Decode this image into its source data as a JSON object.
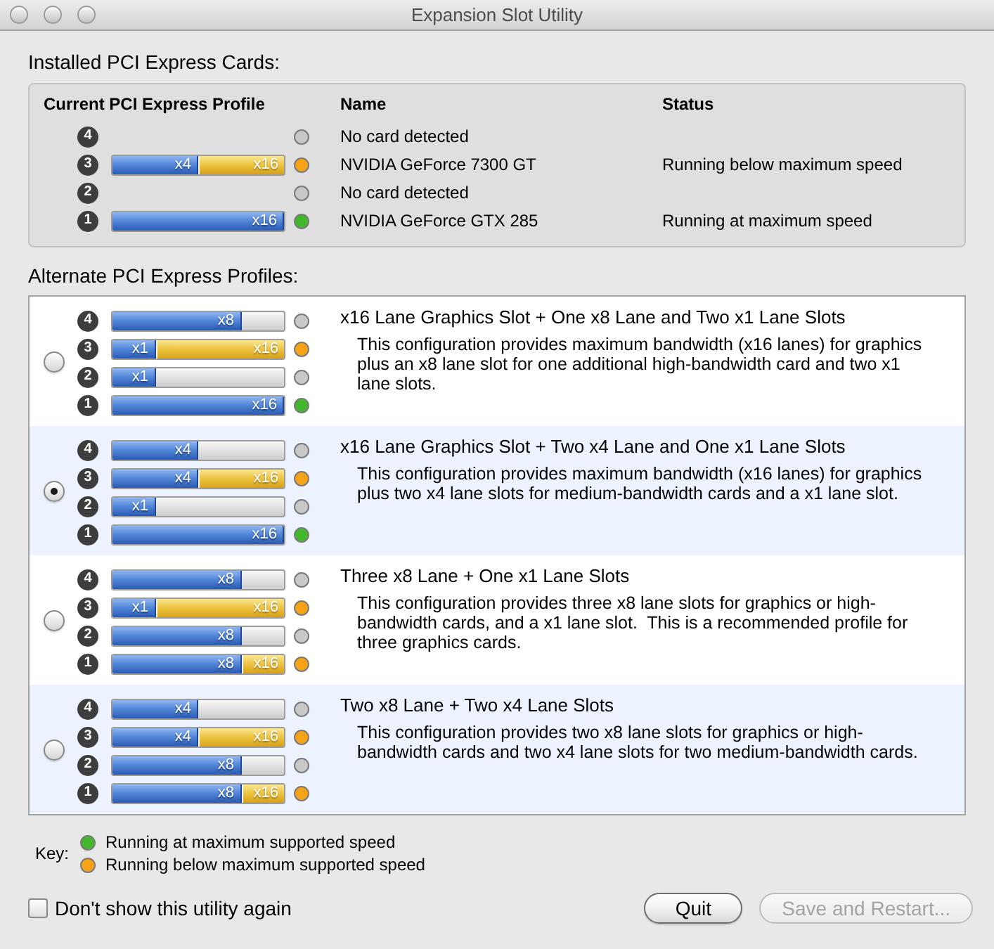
{
  "window": {
    "title": "Expansion Slot Utility"
  },
  "installed": {
    "heading": "Installed PCI Express Cards:",
    "columns": [
      "Current PCI Express Profile",
      "Name",
      "Status"
    ],
    "slots": [
      {
        "number": "4",
        "color": "#c9c9c9",
        "name": "No card detected"
      },
      {
        "number": "3",
        "bar": {
          "lanes": "x4",
          "level": 0.5,
          "card_lanes": "x16"
        },
        "color": "#f6a318",
        "name": "NVIDIA GeForce 7300 GT",
        "status": "Running below maximum speed"
      },
      {
        "number": "2",
        "color": "#c9c9c9",
        "name": "No card detected"
      },
      {
        "number": "1",
        "bar": {
          "lanes": "x16",
          "level": 1
        },
        "color": "#44b82c",
        "name": "NVIDIA GeForce GTX 285",
        "status": "Running at maximum speed"
      }
    ]
  },
  "alternate": {
    "heading": "Alternate PCI Express Profiles:",
    "profiles": [
      {
        "selected": false,
        "title": "x16 Lane Graphics Slot + One x8 Lane and Two x1 Lane Slots",
        "description": "This configuration provides maximum bandwidth (x16 lanes) for graphics plus an x8 lane slot for one additional high-bandwidth card and two x1 lane slots.",
        "slots": [
          {
            "number": "4",
            "bar": {
              "lanes": "x8",
              "level": 0.75
            },
            "color": "#c9c9c9"
          },
          {
            "number": "3",
            "bar": {
              "lanes": "x1",
              "level": 0.25,
              "card_lanes": "x16"
            },
            "color": "#f6a318"
          },
          {
            "number": "2",
            "bar": {
              "lanes": "x1",
              "level": 0.25
            },
            "color": "#c9c9c9"
          },
          {
            "number": "1",
            "bar": {
              "lanes": "x16",
              "level": 1
            },
            "color": "#44b82c"
          }
        ]
      },
      {
        "selected": true,
        "title": "x16 Lane Graphics Slot + Two x4 Lane and One x1 Lane Slots",
        "description": "This configuration provides maximum bandwidth (x16 lanes) for graphics plus two x4 lane slots for medium-bandwidth cards and a x1 lane slot.",
        "slots": [
          {
            "number": "4",
            "bar": {
              "lanes": "x4",
              "level": 0.5
            },
            "color": "#c9c9c9"
          },
          {
            "number": "3",
            "bar": {
              "lanes": "x4",
              "level": 0.5,
              "card_lanes": "x16"
            },
            "color": "#f6a318"
          },
          {
            "number": "2",
            "bar": {
              "lanes": "x1",
              "level": 0.25
            },
            "color": "#c9c9c9"
          },
          {
            "number": "1",
            "bar": {
              "lanes": "x16",
              "level": 1
            },
            "color": "#44b82c"
          }
        ]
      },
      {
        "selected": false,
        "title": "Three x8 Lane + One x1 Lane Slots",
        "description": "This configuration provides three x8 lane slots for graphics or high-bandwidth cards, and a x1 lane slot.  This is a recommended profile for three graphics cards.",
        "slots": [
          {
            "number": "4",
            "bar": {
              "lanes": "x8",
              "level": 0.75
            },
            "color": "#c9c9c9"
          },
          {
            "number": "3",
            "bar": {
              "lanes": "x1",
              "level": 0.25,
              "card_lanes": "x16"
            },
            "color": "#f6a318"
          },
          {
            "number": "2",
            "bar": {
              "lanes": "x8",
              "level": 0.75
            },
            "color": "#c9c9c9"
          },
          {
            "number": "1",
            "bar": {
              "lanes": "x8",
              "level": 0.75,
              "card_lanes": "x16"
            },
            "color": "#f6a318"
          }
        ]
      },
      {
        "selected": false,
        "title": "Two x8 Lane + Two x4 Lane Slots",
        "description": "This configuration provides two x8 lane slots for graphics or high-bandwidth cards and two x4 lane slots for two medium-bandwidth cards.",
        "slots": [
          {
            "number": "4",
            "bar": {
              "lanes": "x4",
              "level": 0.5
            },
            "color": "#c9c9c9"
          },
          {
            "number": "3",
            "bar": {
              "lanes": "x4",
              "level": 0.5,
              "card_lanes": "x16"
            },
            "color": "#f6a318"
          },
          {
            "number": "2",
            "bar": {
              "lanes": "x8",
              "level": 0.75
            },
            "color": "#c9c9c9"
          },
          {
            "number": "1",
            "bar": {
              "lanes": "x8",
              "level": 0.75,
              "card_lanes": "x16"
            },
            "color": "#f6a318"
          }
        ]
      }
    ]
  },
  "key": {
    "label": "Key:",
    "items": [
      {
        "color": "#44b82c",
        "label": "Running at maximum supported speed"
      },
      {
        "color": "#f6a318",
        "label": "Running below maximum supported speed"
      }
    ]
  },
  "dont_show_again": {
    "label": "Don't show this utility again",
    "checked": false
  },
  "buttons": [
    {
      "label": "Quit",
      "disabled": false
    },
    {
      "label": "Save and Restart...",
      "disabled": true
    }
  ]
}
